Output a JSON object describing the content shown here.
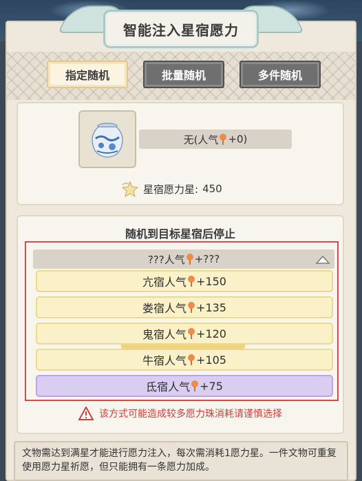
{
  "title": "智能注入星宿愿力",
  "tabs": [
    {
      "label": "指定随机",
      "active": true
    },
    {
      "label": "批量随机",
      "active": false
    },
    {
      "label": "多件随机",
      "active": false
    }
  ],
  "item": {
    "icon": "blue-porcelain-jar-icon",
    "name_prefix": "无(人气",
    "name_suffix": "+0)",
    "power_label": "星宿愿力星:",
    "power_value": "450"
  },
  "selector": {
    "label": "随机到目标星宿后停止",
    "current_prefix": "???人气",
    "current_suffix": "+???",
    "options": [
      {
        "prefix": "亢宿人气",
        "suffix": "+150"
      },
      {
        "prefix": "娄宿人气",
        "suffix": "+135"
      },
      {
        "prefix": "鬼宿人气",
        "suffix": "+120"
      },
      {
        "prefix": "牛宿人气",
        "suffix": "+105"
      },
      {
        "prefix": "氐宿人气",
        "suffix": "+75"
      }
    ]
  },
  "warning": "该方式可能造成较多愿力珠消耗请谨慎选择",
  "note": "文物需达到满星才能进行愿力注入，每次需消耗1愿力星。一件文物可重复使用愿力星祈愿，但只能拥有一条愿力加成。",
  "colors": {
    "accent_red": "#d63b3b",
    "option_yellow": "#fbf1c9",
    "option_purple": "#d9cdf1"
  }
}
